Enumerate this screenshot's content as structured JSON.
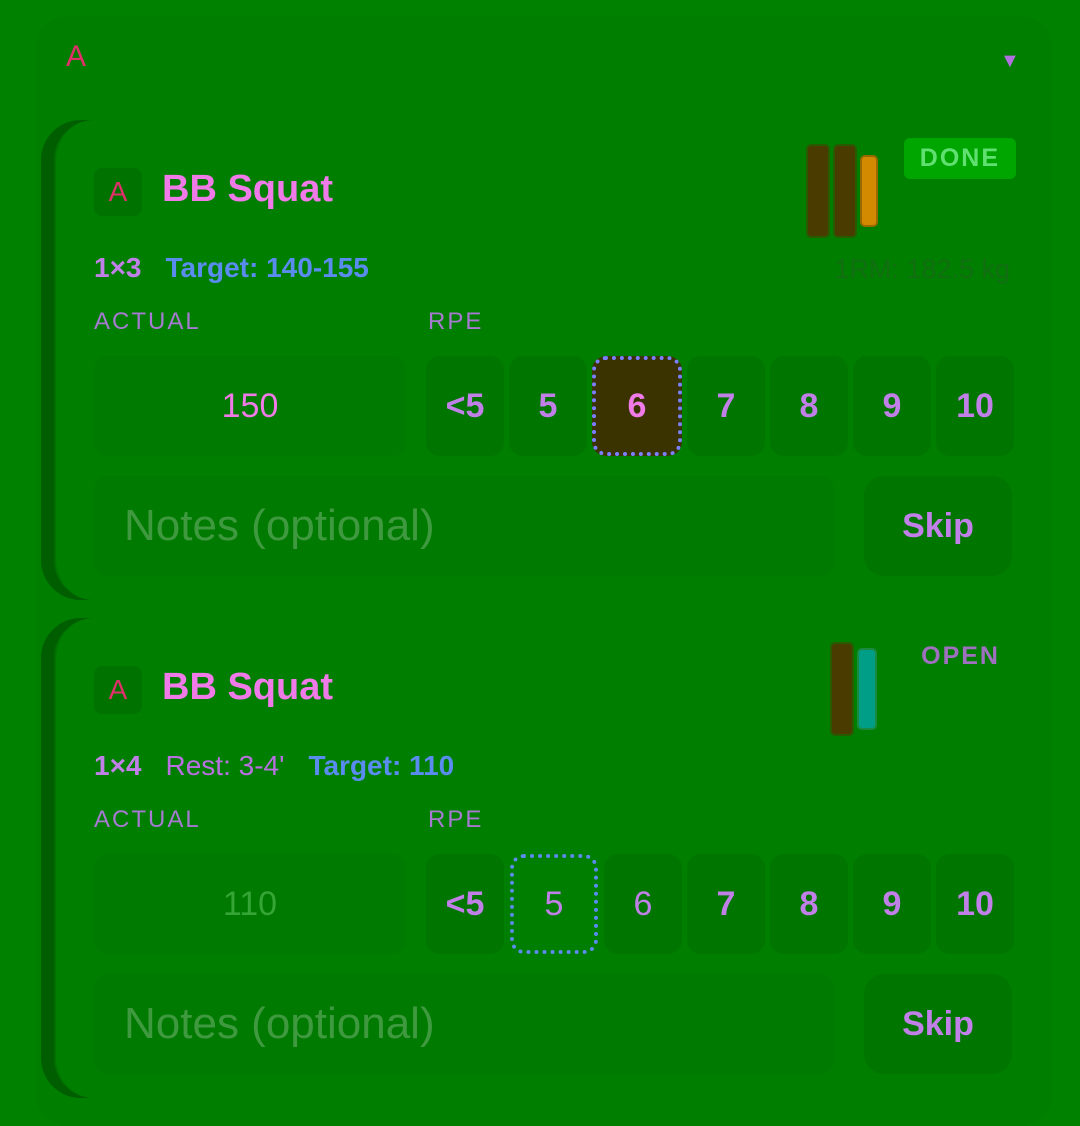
{
  "group": {
    "letter": "A",
    "toggle_icon": "▼"
  },
  "cards": [
    {
      "chip": "A",
      "name": "BB Squat",
      "status": "DONE",
      "scheme": "1×3",
      "rest": "",
      "target": "Target: 140-155",
      "one_rm": "1RM: 182.5 kg",
      "actual_label": "ACTUAL",
      "rpe_label": "RPE",
      "actual_value": "150",
      "rpe_options": [
        "<5",
        "5",
        "6",
        "7",
        "8",
        "9",
        "10"
      ],
      "rpe_selected": "6",
      "notes_placeholder": "Notes (optional)",
      "skip_label": "Skip"
    },
    {
      "chip": "A",
      "name": "BB Squat",
      "status": "OPEN",
      "scheme": "1×4",
      "rest": "Rest: 3-4'",
      "target": "Target: 110",
      "one_rm": "",
      "actual_label": "ACTUAL",
      "rpe_label": "RPE",
      "actual_placeholder": "110",
      "rpe_options": [
        "<5",
        "5",
        "6",
        "7",
        "8",
        "9",
        "10"
      ],
      "rpe_focused": "5",
      "notes_placeholder": "Notes (optional)",
      "skip_label": "Skip"
    }
  ],
  "colors": {
    "background": "#008200",
    "accent_pink": "#f07ae8",
    "accent_purple": "#c080e8",
    "accent_blue": "#5a8cf0",
    "group_red": "#e0306a"
  }
}
